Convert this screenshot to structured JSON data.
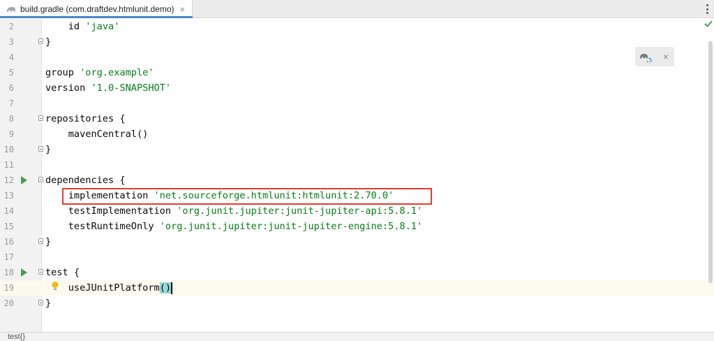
{
  "tab": {
    "title": "build.gradle (com.draftdev.htmlunit.demo)",
    "close_glyph": "×",
    "icon": "gradle-elephant-icon"
  },
  "editor": {
    "lines": [
      {
        "num": "2",
        "segments": [
          {
            "t": "    id ",
            "c": "plain"
          },
          {
            "t": "'java'",
            "c": "str"
          }
        ]
      },
      {
        "num": "3",
        "segments": [
          {
            "t": "}",
            "c": "plain"
          }
        ]
      },
      {
        "num": "4",
        "segments": []
      },
      {
        "num": "5",
        "segments": [
          {
            "t": "group ",
            "c": "plain"
          },
          {
            "t": "'org.example'",
            "c": "str"
          }
        ]
      },
      {
        "num": "6",
        "segments": [
          {
            "t": "version ",
            "c": "plain"
          },
          {
            "t": "'1.0-SNAPSHOT'",
            "c": "str"
          }
        ]
      },
      {
        "num": "7",
        "segments": []
      },
      {
        "num": "8",
        "segments": [
          {
            "t": "repositories {",
            "c": "plain"
          }
        ]
      },
      {
        "num": "9",
        "segments": [
          {
            "t": "    mavenCentral()",
            "c": "plain"
          }
        ]
      },
      {
        "num": "10",
        "segments": [
          {
            "t": "}",
            "c": "plain"
          }
        ]
      },
      {
        "num": "11",
        "segments": []
      },
      {
        "num": "12",
        "segments": [
          {
            "t": "dependencies {",
            "c": "plain"
          }
        ]
      },
      {
        "num": "13",
        "segments": [
          {
            "t": "    implementation ",
            "c": "plain"
          },
          {
            "t": "'net.sourceforge.htmlunit:htmlunit:2.70.0'",
            "c": "str"
          }
        ]
      },
      {
        "num": "14",
        "segments": [
          {
            "t": "    testImplementation ",
            "c": "plain"
          },
          {
            "t": "'org.junit.jupiter:junit-jupiter-api:5.8.1'",
            "c": "str"
          }
        ]
      },
      {
        "num": "15",
        "segments": [
          {
            "t": "    testRuntimeOnly ",
            "c": "plain"
          },
          {
            "t": "'org.junit.jupiter:junit-jupiter-engine:5.8.1'",
            "c": "str"
          }
        ]
      },
      {
        "num": "16",
        "segments": [
          {
            "t": "}",
            "c": "plain"
          }
        ]
      },
      {
        "num": "17",
        "segments": []
      },
      {
        "num": "18",
        "segments": [
          {
            "t": "test {",
            "c": "plain"
          }
        ]
      },
      {
        "num": "19",
        "segments": [
          {
            "t": "    useJUnitPlatform",
            "c": "plain"
          },
          {
            "t": "()",
            "c": "paren"
          }
        ]
      },
      {
        "num": "20",
        "segments": [
          {
            "t": "}",
            "c": "plain"
          }
        ]
      }
    ],
    "fold_markers_on": [
      "3",
      "8",
      "10",
      "12",
      "16",
      "18",
      "20"
    ],
    "run_markers_on": [
      "12",
      "18"
    ],
    "bulb_on": "19",
    "current_line": "19",
    "highlighted_line": "13"
  },
  "popup": {
    "icon": "gradle-reload-icon",
    "close_glyph": "×"
  },
  "status": {
    "breadcrumb": "test{}"
  },
  "colors": {
    "string": "#067d17",
    "highlight_box": "#e53b2c",
    "run_marker": "#499c54",
    "inspection_ok": "#499c54"
  }
}
